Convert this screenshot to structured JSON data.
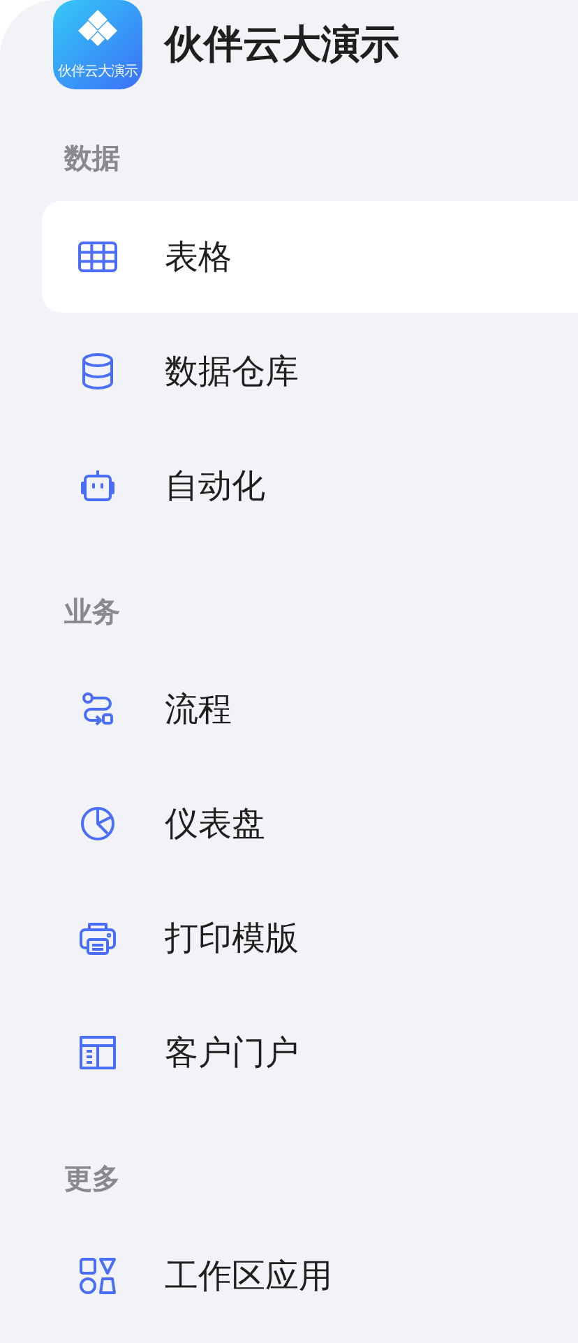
{
  "app": {
    "logo_text": "伙伴云大演示",
    "title": "伙伴云大演示"
  },
  "sections": [
    {
      "title": "数据",
      "items": [
        {
          "label": "表格",
          "kind": "table",
          "selected": true
        },
        {
          "label": "数据仓库",
          "kind": "database",
          "selected": false
        },
        {
          "label": "自动化",
          "kind": "robot",
          "selected": false
        }
      ]
    },
    {
      "title": "业务",
      "items": [
        {
          "label": "流程",
          "kind": "flow",
          "selected": false
        },
        {
          "label": "仪表盘",
          "kind": "pie",
          "selected": false
        },
        {
          "label": "打印模版",
          "kind": "printer",
          "selected": false
        },
        {
          "label": "客户门户",
          "kind": "portal",
          "selected": false
        }
      ]
    },
    {
      "title": "更多",
      "items": [
        {
          "label": "工作区应用",
          "kind": "shapes",
          "selected": false
        }
      ]
    }
  ]
}
